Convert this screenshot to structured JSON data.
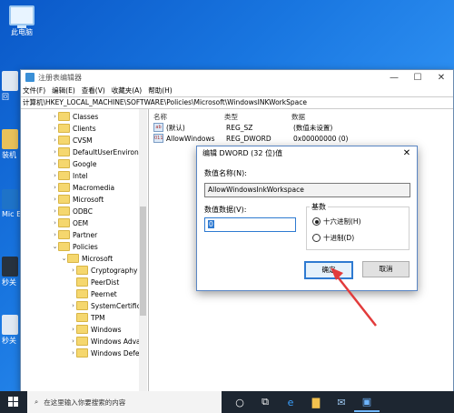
{
  "desktop": {
    "this_pc_label": "此电脑",
    "side_stubs": [
      "回",
      "装机",
      "Mic Ec",
      "秒关",
      "秒关"
    ]
  },
  "window": {
    "title": "注册表编辑器",
    "controls": {
      "minimize": "—",
      "maximize": "☐",
      "close": "✕"
    },
    "menu": [
      "文件(F)",
      "编辑(E)",
      "查看(V)",
      "收藏夹(A)",
      "帮助(H)"
    ],
    "address": "计算机\\HKEY_LOCAL_MACHINE\\SOFTWARE\\Policies\\Microsoft\\WindowsINKWorkSpace",
    "tree": [
      {
        "label": "Classes",
        "level": 0
      },
      {
        "label": "Clients",
        "level": 0
      },
      {
        "label": "CVSM",
        "level": 0
      },
      {
        "label": "DefaultUserEnvironn",
        "level": 0
      },
      {
        "label": "Google",
        "level": 0
      },
      {
        "label": "Intel",
        "level": 0
      },
      {
        "label": "Macromedia",
        "level": 0
      },
      {
        "label": "Microsoft",
        "level": 0
      },
      {
        "label": "ODBC",
        "level": 0
      },
      {
        "label": "OEM",
        "level": 0
      },
      {
        "label": "Partner",
        "level": 0
      },
      {
        "label": "Policies",
        "level": 0,
        "expanded": true
      },
      {
        "label": "Microsoft",
        "level": 1,
        "expanded": true
      },
      {
        "label": "Cryptography",
        "level": 2
      },
      {
        "label": "PeerDist",
        "level": 2
      },
      {
        "label": "Peernet",
        "level": 2
      },
      {
        "label": "SystemCertifica",
        "level": 2
      },
      {
        "label": "TPM",
        "level": 2
      },
      {
        "label": "Windows",
        "level": 2
      },
      {
        "label": "Windows Adva",
        "level": 2
      },
      {
        "label": "Windows Defe",
        "level": 2
      }
    ],
    "columns": {
      "name": "名称",
      "type": "类型",
      "data": "数据"
    },
    "rows": [
      {
        "icon": "ab",
        "name": "(默认)",
        "type": "REG_SZ",
        "data": "(数值未设置)"
      },
      {
        "icon": "011",
        "name": "AllowWindows",
        "type": "REG_DWORD",
        "data": "0x00000000 (0)"
      }
    ]
  },
  "dialog": {
    "title": "编辑 DWORD (32 位)值",
    "close": "✕",
    "name_label": "数值名称(N):",
    "name_value": "AllowWindowsInkWorkspace",
    "data_label": "数值数据(V):",
    "data_value": "0",
    "base_label": "基数",
    "base_options": [
      {
        "label": "十六进制(H)",
        "checked": true
      },
      {
        "label": "十进制(D)",
        "checked": false
      }
    ],
    "ok_label": "确定",
    "cancel_label": "取消"
  },
  "taskbar": {
    "search_placeholder": "在这里输入你要搜索的内容"
  },
  "watermark": "自由互联",
  "colors": {
    "accent": "#2e7ad1",
    "arrow": "#e23b3b",
    "taskbar": "#1d2631"
  }
}
